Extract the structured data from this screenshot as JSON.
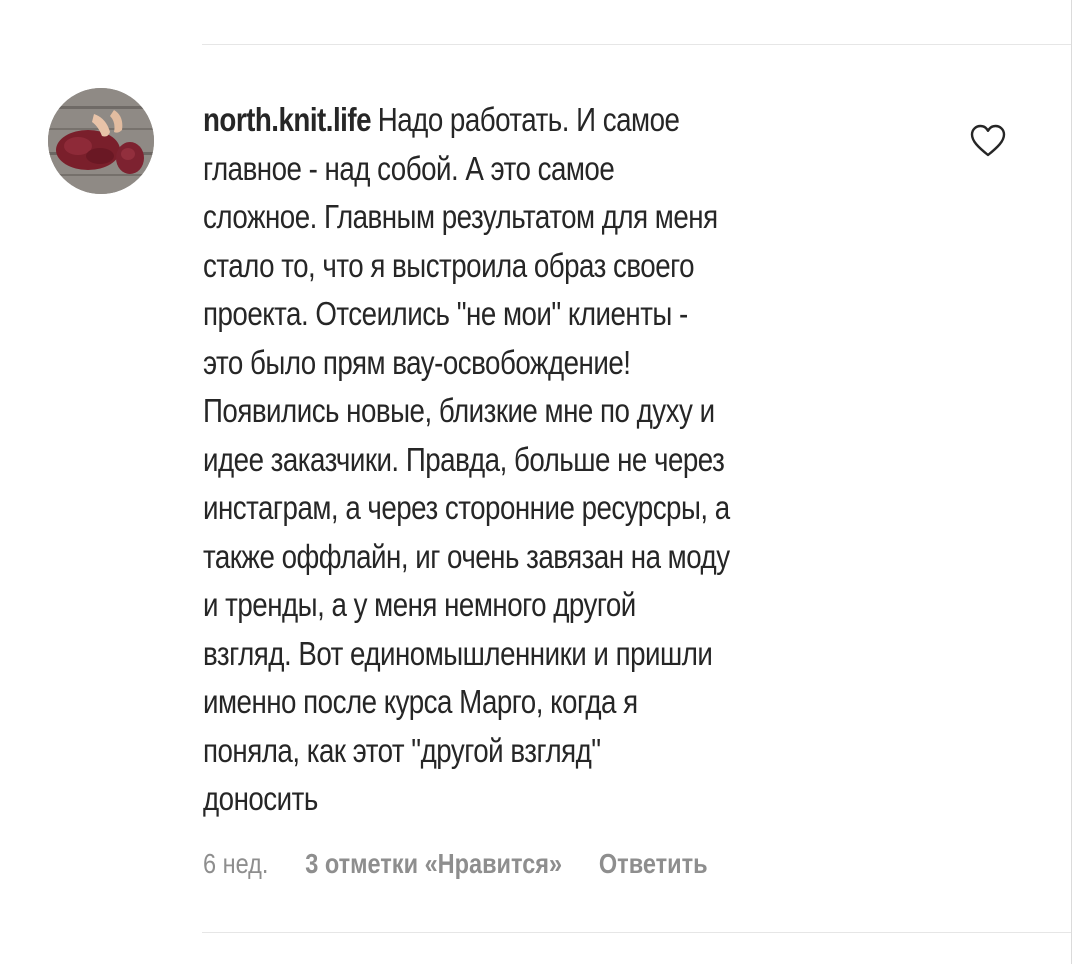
{
  "comment": {
    "username": "north.knit.life",
    "lines": [
      "Надо работать. И самое",
      "главное - над собой. А это самое",
      "сложное. Главным результатом для меня",
      "стало то, что я выстроила образ своего",
      "проекта. Отсеились \"не мои\" клиенты -",
      "это было прям вау-освобождение!",
      "Появились новые, близкие мне по духу и",
      "идее заказчики. Правда, больше не через",
      "инстаграм, а через сторонние ресурсры, а",
      "также оффлайн, иг очень завязан на моду",
      "и тренды, а у меня немного другой",
      "взгляд. Вот единомышленники и пришли",
      "именно после курса Марго, когда я",
      "поняла, как этот \"другой взгляд\"",
      "доносить"
    ],
    "age": "6 нед.",
    "likes_label": "3 отметки «Нравится»",
    "reply_label": "Ответить"
  },
  "icons": {
    "like": "heart-outline-icon",
    "avatar": "knitting-photo"
  },
  "colors": {
    "text": "#262626",
    "meta": "#8e8e8e",
    "divider": "#e6e6e6",
    "yarn": "#7a1f2b"
  }
}
